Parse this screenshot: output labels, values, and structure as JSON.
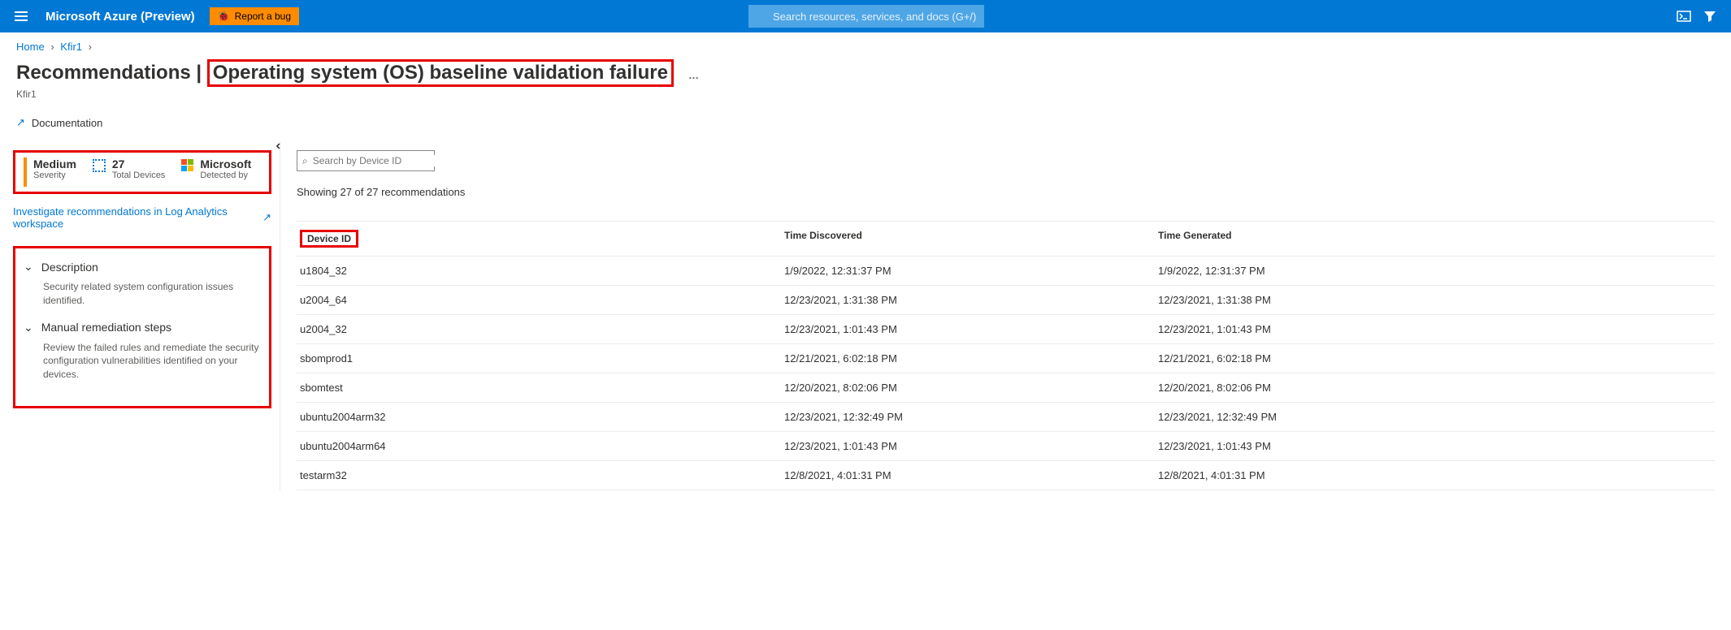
{
  "header": {
    "brand": "Microsoft Azure (Preview)",
    "bug_label": "Report a bug",
    "search_placeholder": "Search resources, services, and docs (G+/)"
  },
  "breadcrumbs": {
    "items": [
      "Home",
      "Kfir1"
    ]
  },
  "page": {
    "title_prefix": "Recommendations",
    "title_main": "Operating system (OS) baseline validation failure",
    "subtitle": "Kfir1",
    "doc_link": "Documentation"
  },
  "stats": {
    "severity": {
      "value": "Medium",
      "label": "Severity"
    },
    "devices": {
      "value": "27",
      "label": "Total Devices"
    },
    "detected": {
      "value": "Microsoft",
      "label": "Detected by"
    }
  },
  "investigate_link": "Investigate recommendations in Log Analytics workspace",
  "sections": {
    "description": {
      "title": "Description",
      "body": "Security related system configuration issues identified."
    },
    "remediation": {
      "title": "Manual remediation steps",
      "body": "Review the failed rules and remediate the security configuration vulnerabilities identified on your devices."
    }
  },
  "device_search": {
    "placeholder": "Search by Device ID"
  },
  "showing_text": "Showing 27 of 27 recommendations",
  "columns": {
    "device": "Device ID",
    "discovered": "Time Discovered",
    "generated": "Time Generated"
  },
  "rows": [
    {
      "device": "u1804_32",
      "discovered": "1/9/2022, 12:31:37 PM",
      "generated": "1/9/2022, 12:31:37 PM"
    },
    {
      "device": "u2004_64",
      "discovered": "12/23/2021, 1:31:38 PM",
      "generated": "12/23/2021, 1:31:38 PM"
    },
    {
      "device": "u2004_32",
      "discovered": "12/23/2021, 1:01:43 PM",
      "generated": "12/23/2021, 1:01:43 PM"
    },
    {
      "device": "sbomprod1",
      "discovered": "12/21/2021, 6:02:18 PM",
      "generated": "12/21/2021, 6:02:18 PM"
    },
    {
      "device": "sbomtest",
      "discovered": "12/20/2021, 8:02:06 PM",
      "generated": "12/20/2021, 8:02:06 PM"
    },
    {
      "device": "ubuntu2004arm32",
      "discovered": "12/23/2021, 12:32:49 PM",
      "generated": "12/23/2021, 12:32:49 PM"
    },
    {
      "device": "ubuntu2004arm64",
      "discovered": "12/23/2021, 1:01:43 PM",
      "generated": "12/23/2021, 1:01:43 PM"
    },
    {
      "device": "testarm32",
      "discovered": "12/8/2021, 4:01:31 PM",
      "generated": "12/8/2021, 4:01:31 PM"
    }
  ]
}
